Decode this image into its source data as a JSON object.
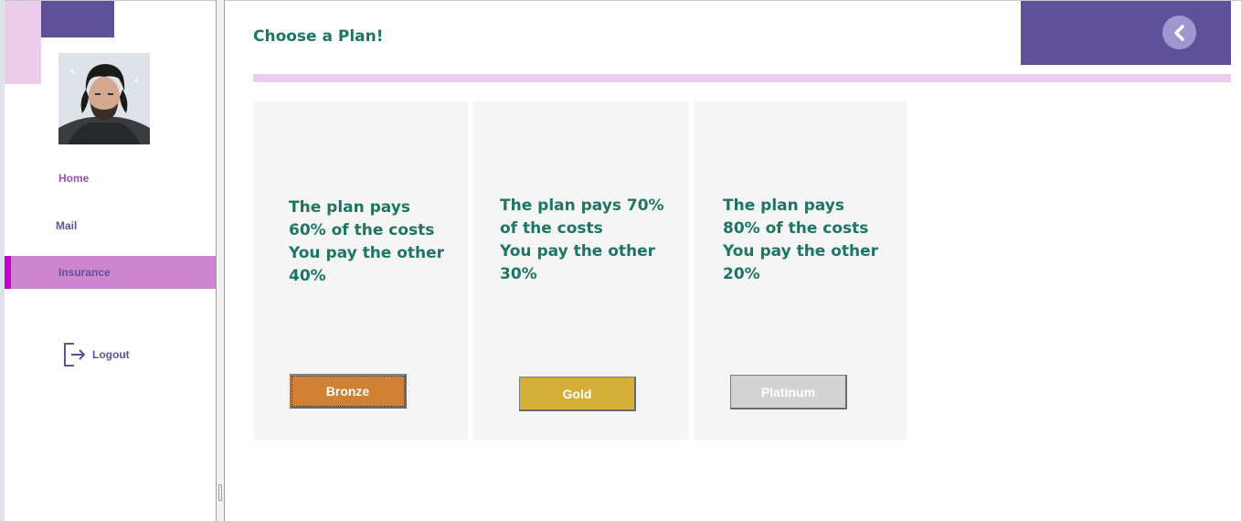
{
  "sidebar": {
    "nav": [
      {
        "label": "Home"
      },
      {
        "label": "Mail"
      },
      {
        "label": "Insurance",
        "active": true
      }
    ],
    "logout_label": "Logout"
  },
  "main": {
    "title": "Choose a Plan!",
    "plans": [
      {
        "text": "The plan pays\n60% of the costs\nYou pay the other\n40%",
        "button": "Bronze",
        "color": "#d08032"
      },
      {
        "text": "The plan pays 70%\nof the costs\nYou pay the other\n30%",
        "button": "Gold",
        "color": "#d4ae36"
      },
      {
        "text": "The plan pays\n80% of the costs\nYou pay the other\n20%",
        "button": "Platinum",
        "color": "#d2d2d2"
      }
    ]
  },
  "colors": {
    "accent_purple": "#5e5199",
    "accent_pink": "#ebcdeb",
    "active_nav": "#cd85cf",
    "heading_green": "#1d7563"
  },
  "icons": [
    "user-avatar",
    "logout-icon",
    "chevron-left-icon"
  ]
}
